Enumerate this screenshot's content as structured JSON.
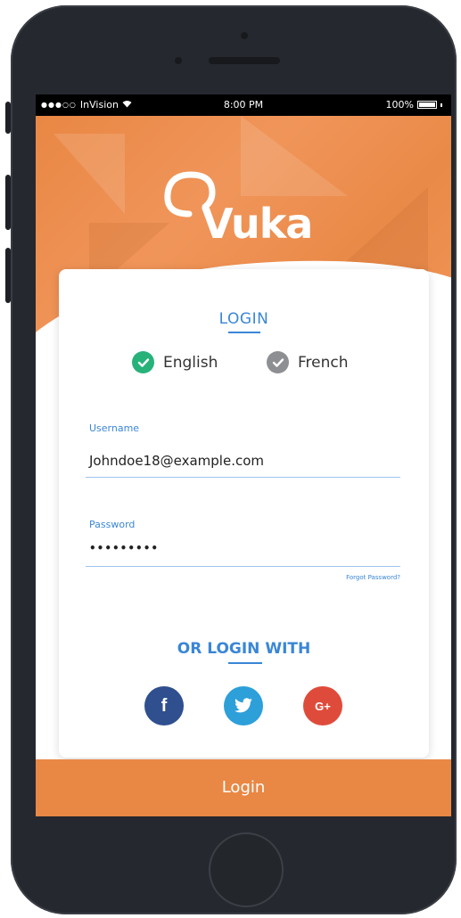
{
  "statusbar": {
    "carrier": "InVision",
    "time": "8:00 PM",
    "battery": "100%"
  },
  "brand": {
    "name": "Vuka",
    "accent_color": "#e98744",
    "link_color": "#3a86d6"
  },
  "login": {
    "title": "LOGIN",
    "languages": [
      {
        "label": "English",
        "selected": true,
        "color": "#27b27a"
      },
      {
        "label": "French",
        "selected": false,
        "color": "#8d8f93"
      }
    ],
    "username": {
      "label": "Username",
      "value": "Johndoe18@example.com"
    },
    "password": {
      "label": "Password",
      "value": "•••••••••"
    },
    "forgot_password": "Forgot Password?"
  },
  "social": {
    "title": "OR LOGIN WITH",
    "providers": [
      {
        "name": "facebook-icon",
        "glyph": "f",
        "color": "#2f4f8f"
      },
      {
        "name": "twitter-icon",
        "glyph": "t",
        "color": "#2d9fd9"
      },
      {
        "name": "google-plus-icon",
        "glyph": "G+",
        "color": "#df4b3b"
      }
    ]
  },
  "footer": {
    "login_button": "Login"
  }
}
